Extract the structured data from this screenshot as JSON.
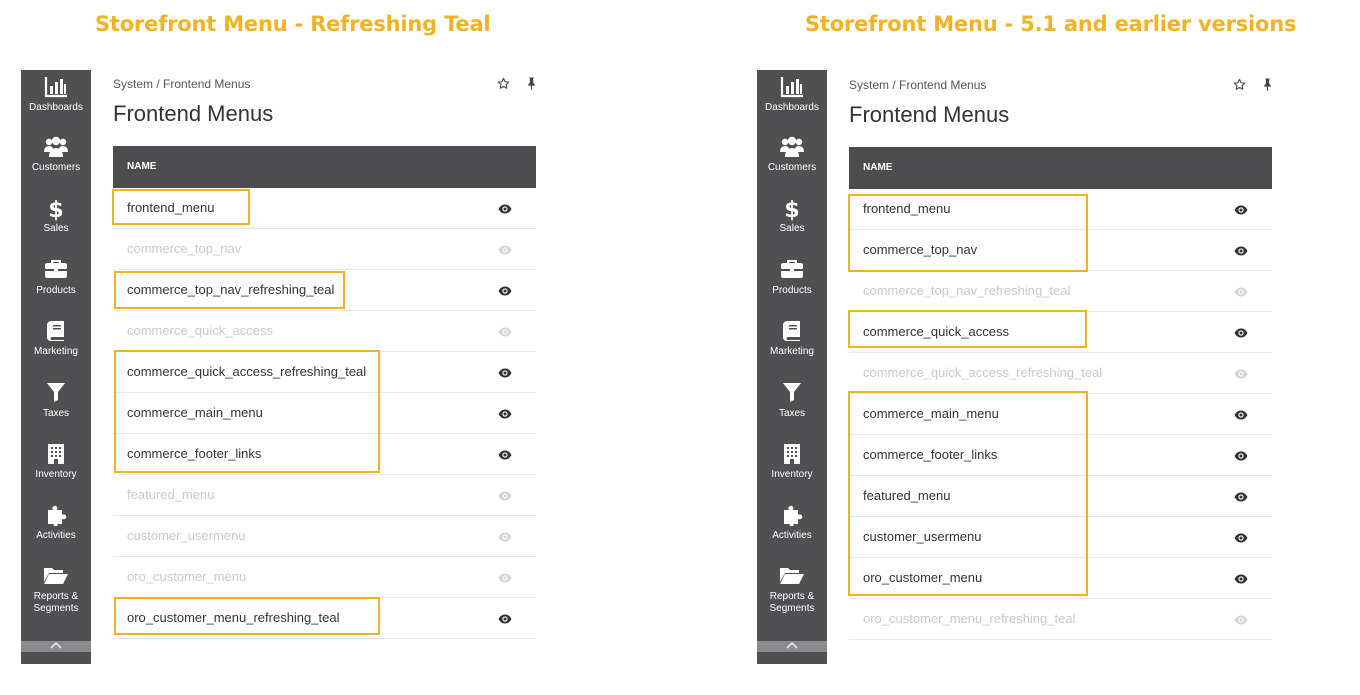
{
  "left": {
    "heading": "Storefront Menu - Refreshing Teal",
    "sidebar": [
      {
        "label": "Dashboards",
        "icon": "bar-chart-icon"
      },
      {
        "label": "Customers",
        "icon": "users-icon"
      },
      {
        "label": "Sales",
        "icon": "dollar-icon"
      },
      {
        "label": "Products",
        "icon": "briefcase-icon"
      },
      {
        "label": "Marketing",
        "icon": "book-icon"
      },
      {
        "label": "Taxes",
        "icon": "filter-icon"
      },
      {
        "label": "Inventory",
        "icon": "building-icon"
      },
      {
        "label": "Activities",
        "icon": "puzzle-icon"
      },
      {
        "label": "Reports &",
        "label2": "Segments",
        "icon": "folder-open-icon"
      }
    ],
    "breadcrumb": "System / Frontend Menus",
    "title": "Frontend Menus",
    "column_header": "NAME",
    "rows": [
      {
        "name": "frontend_menu",
        "enabled": true
      },
      {
        "name": "commerce_top_nav",
        "enabled": false
      },
      {
        "name": "commerce_top_nav_refreshing_teal",
        "enabled": true
      },
      {
        "name": "commerce_quick_access",
        "enabled": false
      },
      {
        "name": "commerce_quick_access_refreshing_teal",
        "enabled": true
      },
      {
        "name": "commerce_main_menu",
        "enabled": true
      },
      {
        "name": "commerce_footer_links",
        "enabled": true
      },
      {
        "name": "featured_menu",
        "enabled": false
      },
      {
        "name": "customer_usermenu",
        "enabled": false
      },
      {
        "name": "oro_customer_menu",
        "enabled": false
      },
      {
        "name": "oro_customer_menu_refreshing_teal",
        "enabled": true
      }
    ]
  },
  "right": {
    "heading": "Storefront Menu - 5.1 and earlier versions",
    "sidebar": [
      {
        "label": "Dashboards",
        "icon": "bar-chart-icon"
      },
      {
        "label": "Customers",
        "icon": "users-icon"
      },
      {
        "label": "Sales",
        "icon": "dollar-icon"
      },
      {
        "label": "Products",
        "icon": "briefcase-icon"
      },
      {
        "label": "Marketing",
        "icon": "book-icon"
      },
      {
        "label": "Taxes",
        "icon": "filter-icon"
      },
      {
        "label": "Inventory",
        "icon": "building-icon"
      },
      {
        "label": "Activities",
        "icon": "puzzle-icon"
      },
      {
        "label": "Reports &",
        "label2": "Segments",
        "icon": "folder-open-icon"
      }
    ],
    "breadcrumb": "System / Frontend Menus",
    "title": "Frontend Menus",
    "column_header": "NAME",
    "rows": [
      {
        "name": "frontend_menu",
        "enabled": true
      },
      {
        "name": "commerce_top_nav",
        "enabled": true
      },
      {
        "name": "commerce_top_nav_refreshing_teal",
        "enabled": false
      },
      {
        "name": "commerce_quick_access",
        "enabled": true
      },
      {
        "name": "commerce_quick_access_refreshing_teal",
        "enabled": false
      },
      {
        "name": "commerce_main_menu",
        "enabled": true
      },
      {
        "name": "commerce_footer_links",
        "enabled": true
      },
      {
        "name": "featured_menu",
        "enabled": true
      },
      {
        "name": "customer_usermenu",
        "enabled": true
      },
      {
        "name": "oro_customer_menu",
        "enabled": true
      },
      {
        "name": "oro_customer_menu_refreshing_teal",
        "enabled": false
      }
    ]
  },
  "colors": {
    "heading_accent": "#f0b323",
    "highlight": "#f0b323",
    "sidebar_bg": "#505052",
    "grid_header_bg": "#4d4d4f",
    "disabled_text": "#c9c9c9"
  },
  "toolbar_icons": [
    "star-icon",
    "pin-icon"
  ]
}
